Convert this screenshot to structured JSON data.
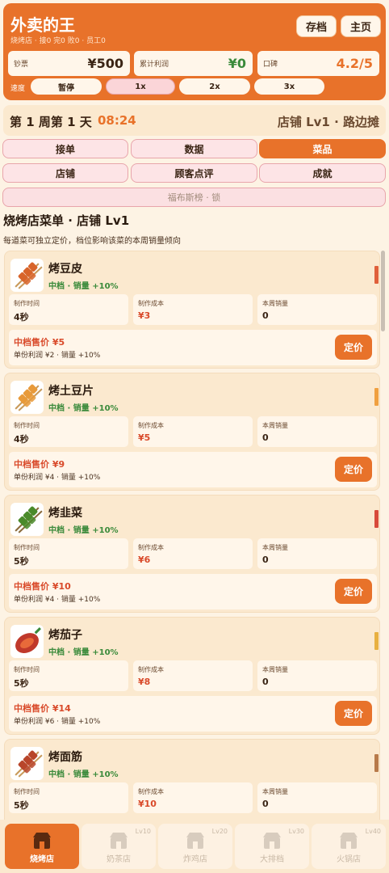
{
  "header": {
    "title": "外卖的王",
    "subtitle": "烧烤店 · 接0 完0 败0 · 员工0",
    "save_label": "存档",
    "home_label": "主页",
    "stats": [
      {
        "label": "钞票",
        "value": "¥500",
        "color": "#3a2414"
      },
      {
        "label": "累计利润",
        "value": "¥0",
        "color": "#3a8a3a"
      },
      {
        "label": "口碑",
        "value": "4.2/5",
        "color": "#e8722a"
      }
    ],
    "speed_label": "速度",
    "speeds": [
      "暂停",
      "1x",
      "2x",
      "3x"
    ],
    "active_speed": "1x"
  },
  "week": {
    "title": "第 1 周第 1 天",
    "time": "08:24",
    "shop_level": "店铺 Lv1 · 路边摊"
  },
  "tabs": {
    "row1": [
      "接单",
      "数据",
      "菜品"
    ],
    "row2": [
      "店铺",
      "顾客点评",
      "成就"
    ],
    "locked": "福布斯榜 · 锁",
    "active": "菜品"
  },
  "menu": {
    "title": "烧烤店菜单 · 店铺 Lv1",
    "desc": "每道菜可独立定价，档位影响该菜的本周销量倾向"
  },
  "labels": {
    "cook_time": "制作时间",
    "cost": "制作成本",
    "week_sales": "本周销量",
    "price_button": "定价"
  },
  "dishes": [
    {
      "name": "烤豆皮",
      "tag": "中档 · 销量 +10%",
      "cook_time": "4秒",
      "cost": "¥3",
      "sales": "0",
      "price": "中档售价 ¥5",
      "profit": "单份利润 ¥2 · 销量 +10%",
      "bar_color": "#e0603a",
      "icon": "skewer-icon"
    },
    {
      "name": "烤土豆片",
      "tag": "中档 · 销量 +10%",
      "cook_time": "4秒",
      "cost": "¥5",
      "sales": "0",
      "price": "中档售价 ¥9",
      "profit": "单份利润 ¥4 · 销量 +10%",
      "bar_color": "#f0a040",
      "icon": "potato-skewer-icon"
    },
    {
      "name": "烤韭菜",
      "tag": "中档 · 销量 +10%",
      "cook_time": "5秒",
      "cost": "¥6",
      "sales": "0",
      "price": "中档售价 ¥10",
      "profit": "单份利润 ¥4 · 销量 +10%",
      "bar_color": "#d84a3a",
      "icon": "chive-skewer-icon"
    },
    {
      "name": "烤茄子",
      "tag": "中档 · 销量 +10%",
      "cook_time": "5秒",
      "cost": "¥8",
      "sales": "0",
      "price": "中档售价 ¥14",
      "profit": "单份利润 ¥6 · 销量 +10%",
      "bar_color": "#e8b040",
      "icon": "eggplant-icon"
    },
    {
      "name": "烤面筋",
      "tag": "中档 · 销量 +10%",
      "cook_time": "5秒",
      "cost": "¥10",
      "sales": "0",
      "price": "",
      "profit": "",
      "bar_color": "#b87a4a",
      "icon": "gluten-skewer-icon"
    }
  ],
  "bottom_nav": [
    {
      "label": "烧烤店",
      "level": "",
      "active": true,
      "icon": "bbq-shop-icon"
    },
    {
      "label": "奶茶店",
      "level": "Lv10",
      "active": false,
      "icon": "milk-tea-shop-icon"
    },
    {
      "label": "炸鸡店",
      "level": "Lv20",
      "active": false,
      "icon": "fried-chicken-shop-icon"
    },
    {
      "label": "大排档",
      "level": "Lv30",
      "active": false,
      "icon": "food-stall-icon"
    },
    {
      "label": "火锅店",
      "level": "Lv40",
      "active": false,
      "icon": "hotpot-shop-icon"
    }
  ]
}
